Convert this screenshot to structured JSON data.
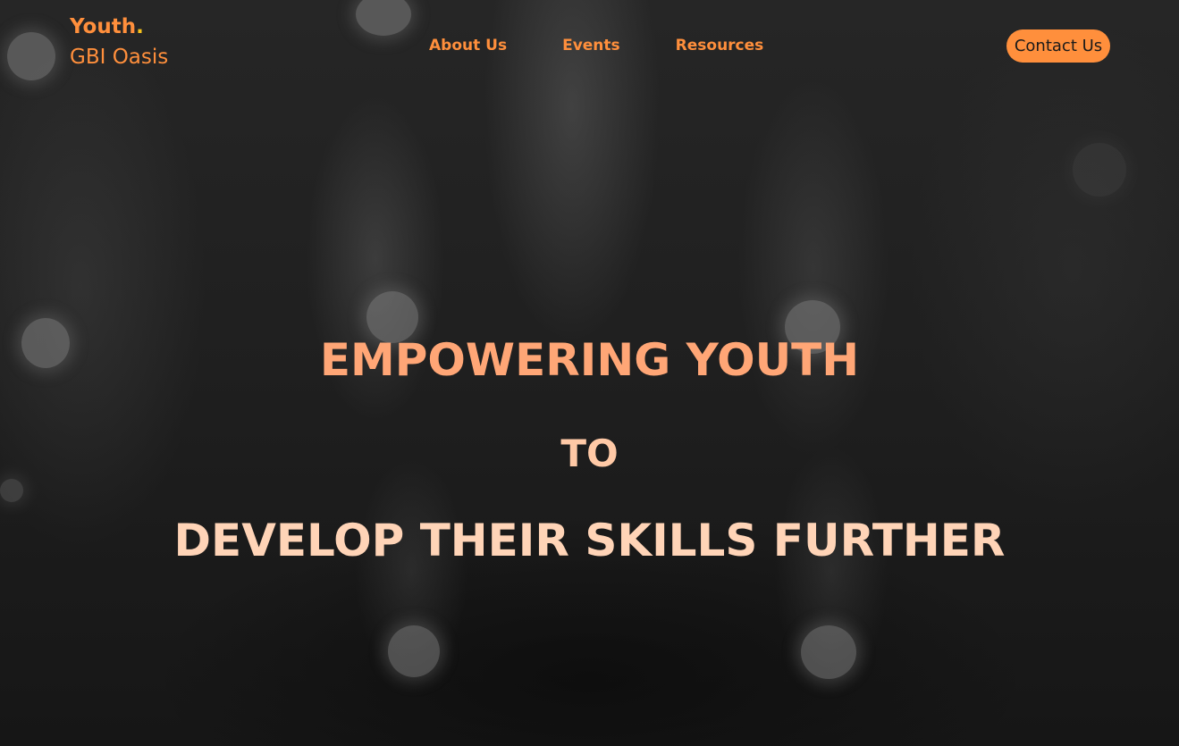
{
  "brand": {
    "name": "Youth",
    "dot": ".",
    "subtitle": "GBI Oasis"
  },
  "nav": {
    "items": [
      {
        "label": "About Us"
      },
      {
        "label": "Events"
      },
      {
        "label": "Resources"
      }
    ]
  },
  "contact": {
    "label": "Contact Us"
  },
  "hero": {
    "line1": "EMPOWERING YOUTH",
    "line2": "TO",
    "line3": "DEVELOP THEIR SKILLS FURTHER"
  },
  "colors": {
    "accent": "#ff8f3c",
    "dot": "#f6c21c",
    "hero_text": "#ffa676",
    "background": "#1c1c1c"
  },
  "background": {
    "icon": "concert-crowd-background"
  }
}
